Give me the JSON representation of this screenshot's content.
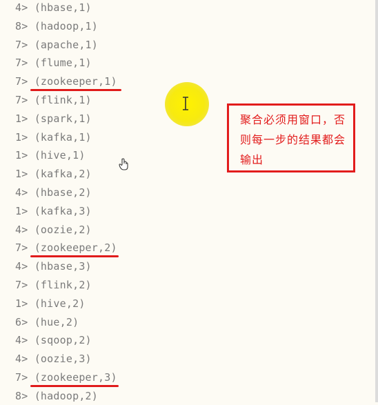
{
  "console": {
    "lines": [
      {
        "prefix": "4>",
        "text": "(hbase,1)"
      },
      {
        "prefix": "8>",
        "text": "(hadoop,1)"
      },
      {
        "prefix": "7>",
        "text": "(apache,1)"
      },
      {
        "prefix": "7>",
        "text": "(flume,1)"
      },
      {
        "prefix": "7>",
        "text": "(zookeeper,1)"
      },
      {
        "prefix": "7>",
        "text": "(flink,1)"
      },
      {
        "prefix": "1>",
        "text": "(spark,1)"
      },
      {
        "prefix": "1>",
        "text": "(kafka,1)"
      },
      {
        "prefix": "1>",
        "text": "(hive,1)"
      },
      {
        "prefix": "1>",
        "text": "(kafka,2)"
      },
      {
        "prefix": "4>",
        "text": "(hbase,2)"
      },
      {
        "prefix": "1>",
        "text": "(kafka,3)"
      },
      {
        "prefix": "4>",
        "text": "(oozie,2)"
      },
      {
        "prefix": "7>",
        "text": "(zookeeper,2)"
      },
      {
        "prefix": "4>",
        "text": "(hbase,3)"
      },
      {
        "prefix": "7>",
        "text": "(flink,2)"
      },
      {
        "prefix": "1>",
        "text": "(hive,2)"
      },
      {
        "prefix": "6>",
        "text": "(hue,2)"
      },
      {
        "prefix": "4>",
        "text": "(sqoop,2)"
      },
      {
        "prefix": "4>",
        "text": "(oozie,3)"
      },
      {
        "prefix": "7>",
        "text": "(zookeeper,3)"
      },
      {
        "prefix": "8>",
        "text": "(hadoop,2)"
      }
    ],
    "highlighted_lines": [
      "(zookeeper,1)",
      "(zookeeper,2)",
      "(zookeeper,3)"
    ]
  },
  "annotation": {
    "note": "聚合必须用窗口，否则每一步的结果都会输出"
  },
  "colors": {
    "background": "#fdfbf4",
    "text": "#7a7a7a",
    "annotation_red": "#e21c1c",
    "cursor_highlight": "#fff200"
  },
  "icons": {
    "text_cursor": "ibeam-cursor-icon",
    "pointer": "hand-cursor-icon"
  }
}
